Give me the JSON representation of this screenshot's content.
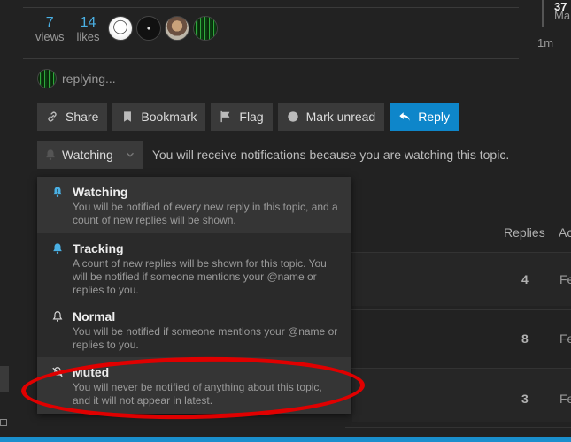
{
  "stats": {
    "views": {
      "value": "7",
      "label": "views"
    },
    "likes": {
      "value": "14",
      "label": "likes"
    }
  },
  "timeline": {
    "top": "37",
    "month": "Ma",
    "ago": "1m"
  },
  "replying": "replying...",
  "actions": {
    "share": "Share",
    "bookmark": "Bookmark",
    "flag": "Flag",
    "mark_unread": "Mark unread",
    "reply": "Reply"
  },
  "notifications": {
    "current": "Watching",
    "reason": "You will receive notifications because you are watching this topic.",
    "options": [
      {
        "title": "Watching",
        "desc": "You will be notified of every new reply in this topic, and a count of new replies will be shown.",
        "icon": "bell-icon"
      },
      {
        "title": "Tracking",
        "desc": "A count of new replies will be shown for this topic. You will be notified if someone mentions your @name or replies to you.",
        "icon": "bell-icon"
      },
      {
        "title": "Normal",
        "desc": "You will be notified if someone mentions your @name or replies to you.",
        "icon": "bell-outline-icon"
      },
      {
        "title": "Muted",
        "desc": "You will never be notified of anything about this topic, and it will not appear in latest.",
        "icon": "bell-slash-icon"
      }
    ]
  },
  "topic_list": {
    "headers": {
      "replies": "Replies",
      "activity": "Ac"
    },
    "rows": [
      {
        "replies": "4",
        "activity": "Fe"
      },
      {
        "replies": "8",
        "activity": "Fe"
      },
      {
        "replies": "3",
        "activity": "Fe"
      }
    ]
  },
  "colors": {
    "accent": "#0e86ca",
    "bell_active": "#4ab0e4",
    "highlight_ring": "#e00000"
  }
}
